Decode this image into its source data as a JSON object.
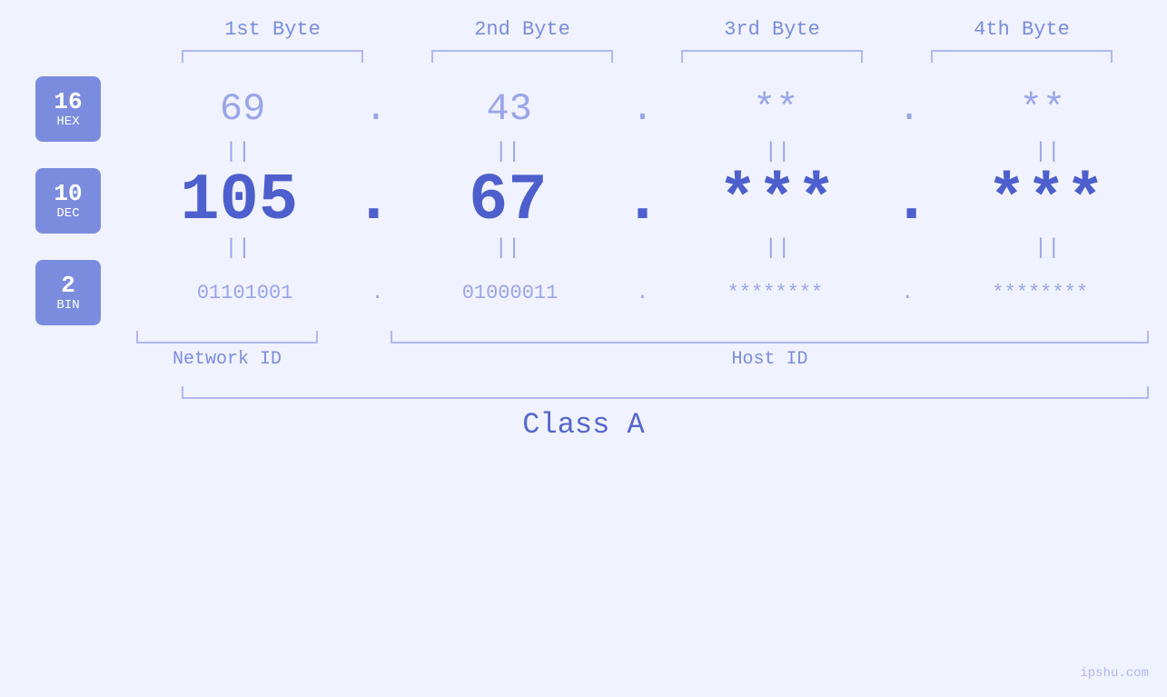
{
  "headers": {
    "byte1": "1st Byte",
    "byte2": "2nd Byte",
    "byte3": "3rd Byte",
    "byte4": "4th Byte"
  },
  "bases": {
    "hex": {
      "number": "16",
      "label": "HEX"
    },
    "dec": {
      "number": "10",
      "label": "DEC"
    },
    "bin": {
      "number": "2",
      "label": "BIN"
    }
  },
  "values": {
    "hex": {
      "b1": "69",
      "b2": "43",
      "b3": "**",
      "b4": "**"
    },
    "dec": {
      "b1": "105",
      "b2": "67",
      "b3": "***",
      "b4": "***"
    },
    "bin": {
      "b1": "01101001",
      "b2": "01000011",
      "b3": "********",
      "b4": "********"
    }
  },
  "labels": {
    "network_id": "Network ID",
    "host_id": "Host ID",
    "class": "Class A"
  },
  "watermark": "ipshu.com",
  "separator": ".",
  "equals": "||"
}
